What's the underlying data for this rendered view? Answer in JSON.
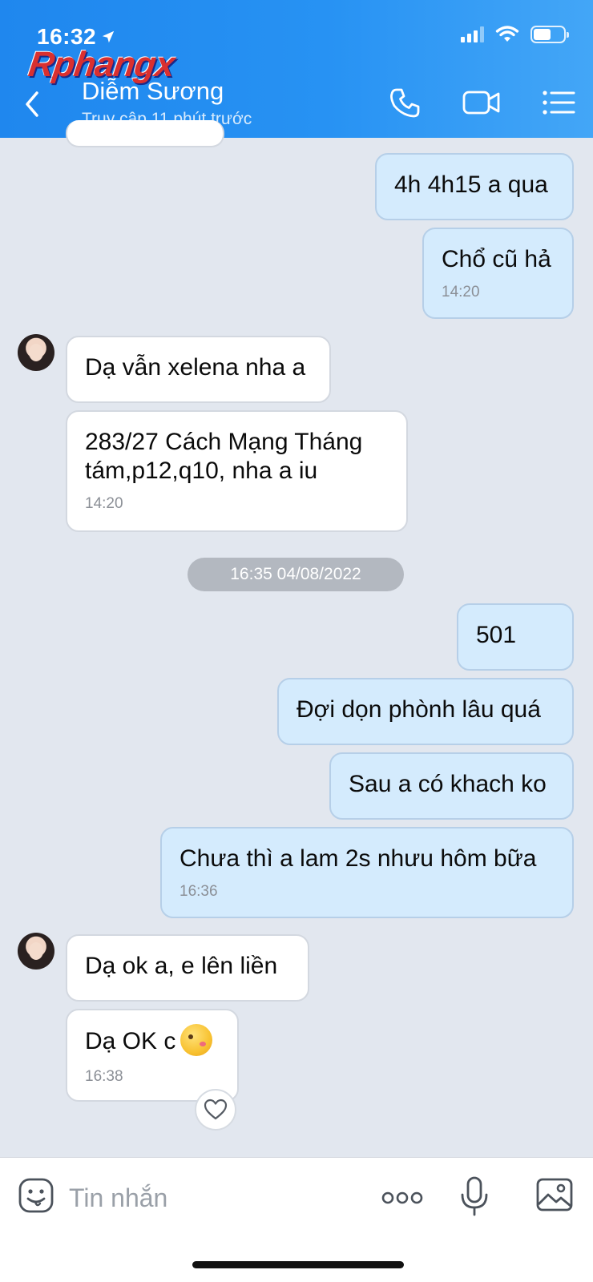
{
  "status_bar": {
    "time": "16:32"
  },
  "watermark": "Rphangx",
  "header": {
    "contact_name": "Diễm Sương",
    "contact_status": "Truy cập 11 phút trước"
  },
  "messages": [
    {
      "direction": "sent",
      "text": "4h 4h15 a qua",
      "time": ""
    },
    {
      "direction": "sent",
      "text": "Chổ cũ hả",
      "time": "14:20"
    },
    {
      "direction": "received",
      "text": "Dạ vẫn xelena nha a",
      "time": ""
    },
    {
      "direction": "received",
      "text": "283/27 Cách Mạng Tháng tám,p12,q10, nha a iu",
      "time": "14:20"
    },
    {
      "direction": "sent",
      "text": "501",
      "time": ""
    },
    {
      "direction": "sent",
      "text": "Đợi dọn phònh lâu quá",
      "time": ""
    },
    {
      "direction": "sent",
      "text": "Sau a có khach ko",
      "time": ""
    },
    {
      "direction": "sent",
      "text": "Chưa thì a lam 2s nhưu hôm bữa",
      "time": "16:36"
    },
    {
      "direction": "received",
      "text": "Dạ ok a, e lên liền",
      "time": ""
    },
    {
      "direction": "received",
      "text": "Dạ OK c",
      "time": "16:38",
      "emoji": "kissing-face-emoji"
    }
  ],
  "date_separator": "16:35 04/08/2022",
  "input": {
    "placeholder": "Tin nhắn"
  },
  "colors": {
    "header_blue": "#2792f3",
    "sent_bubble": "#d4ebfd",
    "received_bubble": "#ffffff",
    "chat_background": "#e2e7ef"
  }
}
